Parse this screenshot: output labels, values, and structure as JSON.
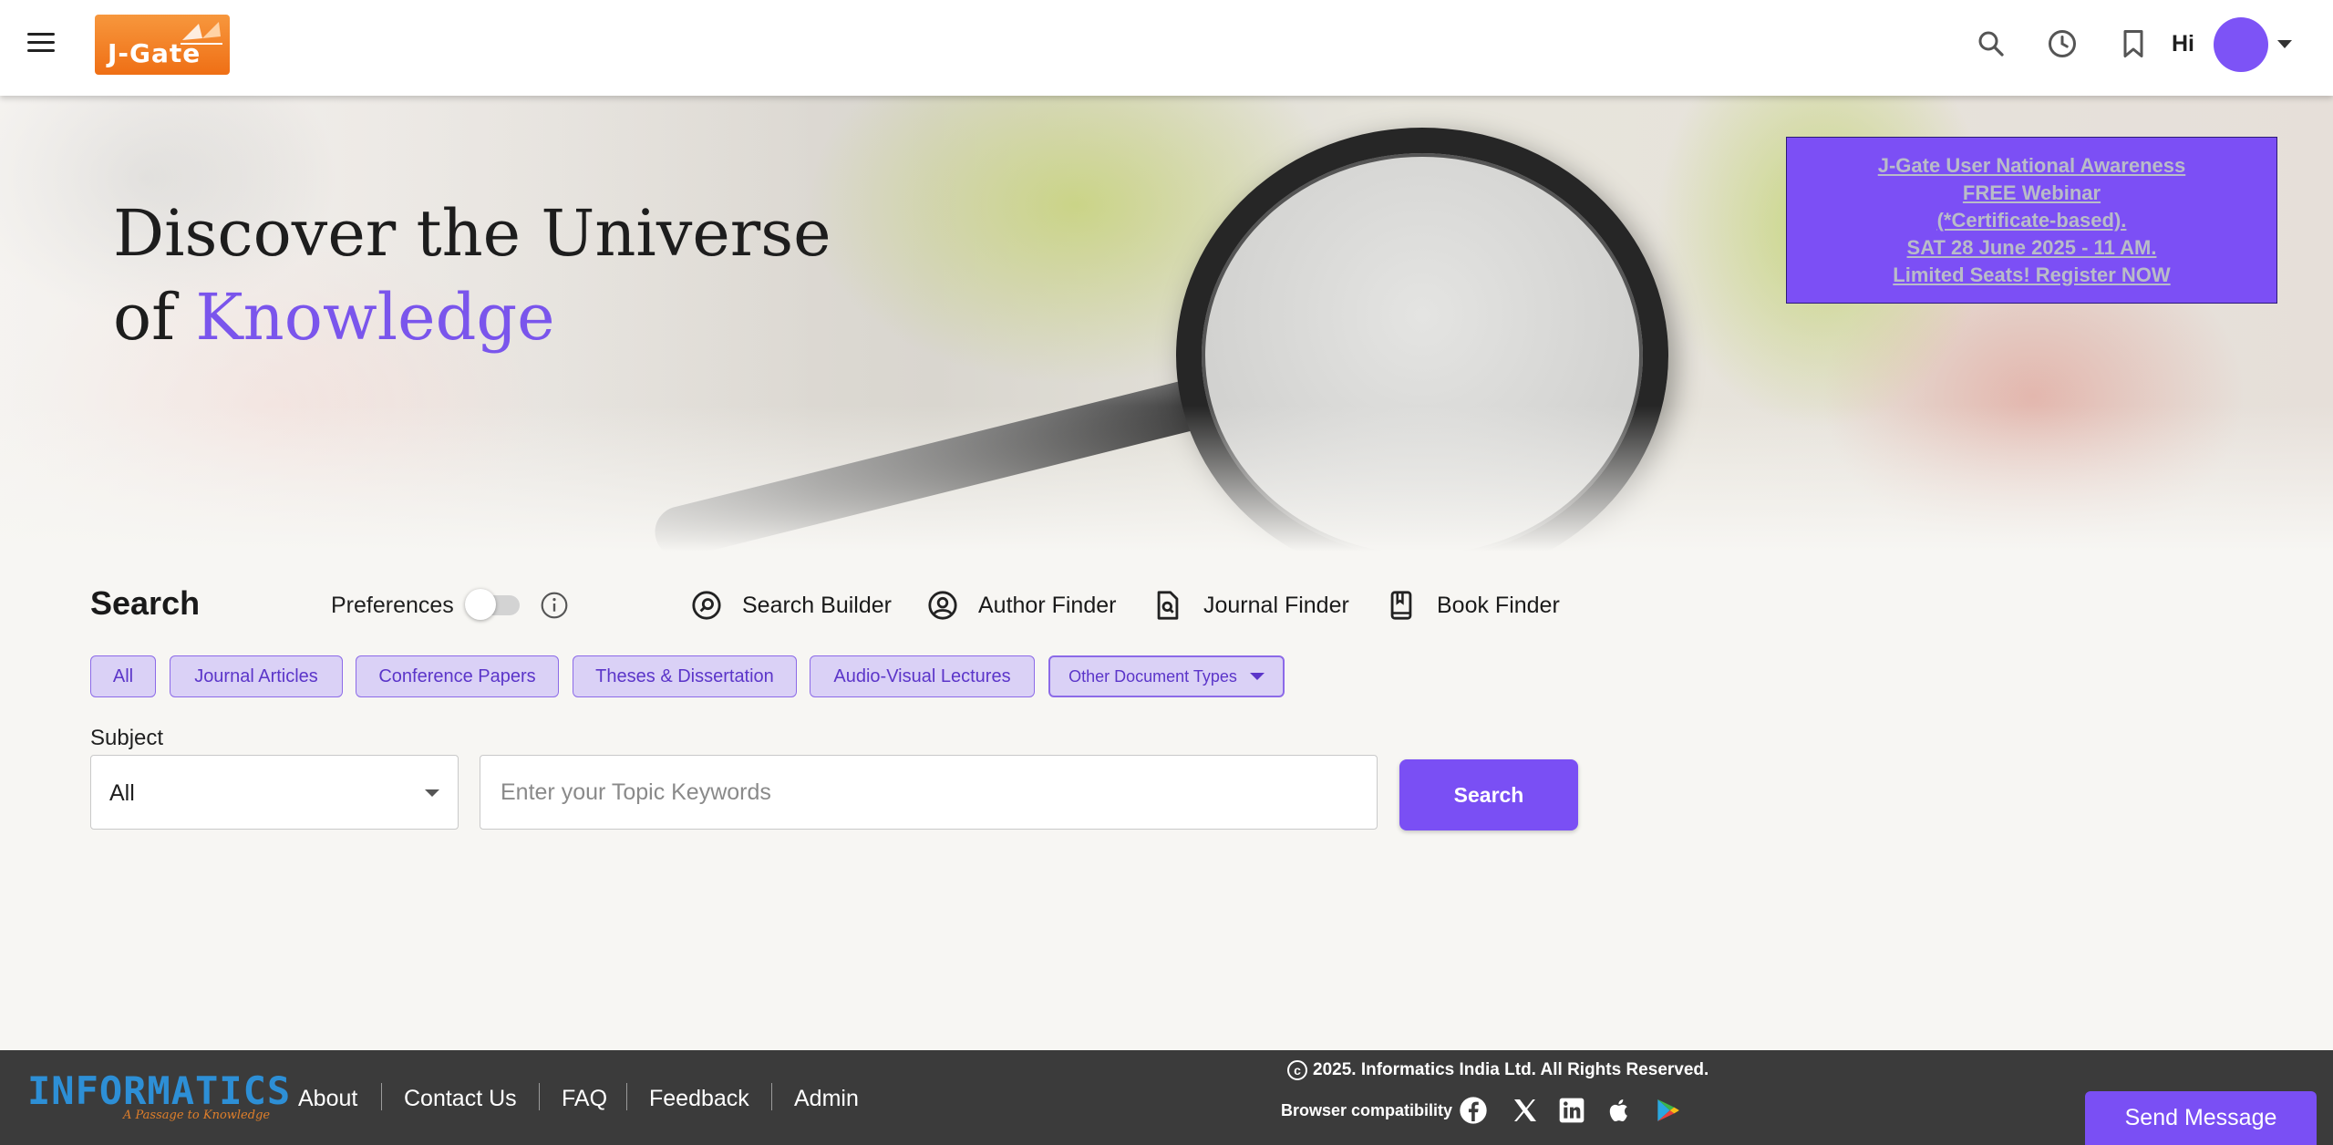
{
  "header": {
    "logo_text": "J-Gate",
    "greeting": "Hi",
    "icons": [
      "menu-icon",
      "search-icon",
      "history-icon",
      "bookmark-icon",
      "avatar",
      "chevron-down-icon"
    ]
  },
  "hero": {
    "title_line1": "Discover the Universe",
    "title_line2_prefix": "of ",
    "title_line2_accent": "Knowledge",
    "banner": {
      "line1": "J-Gate User National Awareness",
      "line2": "FREE Webinar",
      "line3": "(*Certificate-based).",
      "line4": "SAT 28 June 2025 - 11 AM.",
      "line5": "Limited Seats! Register NOW"
    }
  },
  "search": {
    "title": "Search",
    "preferences_label": "Preferences",
    "preferences_enabled": false,
    "tools": [
      {
        "label": "Search Builder",
        "icon": "search-builder-icon"
      },
      {
        "label": "Author Finder",
        "icon": "author-icon"
      },
      {
        "label": "Journal Finder",
        "icon": "journal-search-icon"
      },
      {
        "label": "Book Finder",
        "icon": "book-icon"
      }
    ],
    "doc_types": [
      "All",
      "Journal Articles",
      "Conference Papers",
      "Theses & Dissertation",
      "Audio-Visual Lectures"
    ],
    "other_doc_types": "Other Document Types",
    "subject_label": "Subject",
    "subject_value": "All",
    "keyword_placeholder": "Enter your Topic Keywords",
    "keyword_value": "",
    "search_button": "Search"
  },
  "footer": {
    "brand": "INFORMATICS",
    "brand_tagline": "A Passage to Knowledge",
    "links": [
      "About",
      "Contact Us",
      "FAQ",
      "Feedback",
      "Admin"
    ],
    "copyright": "2025. Informatics India Ltd. All Rights Reserved.",
    "browser_compat": "Browser compatibility",
    "social_icons": [
      "facebook-icon",
      "x-icon",
      "linkedin-icon",
      "apple-icon",
      "google-play-icon"
    ],
    "send_message": "Send Message"
  },
  "colors": {
    "accent": "#7a4ff4",
    "chip_bg": "#dad1f6",
    "footer_bg": "#3b3b3b",
    "logo_orange": "#ef6f15"
  }
}
